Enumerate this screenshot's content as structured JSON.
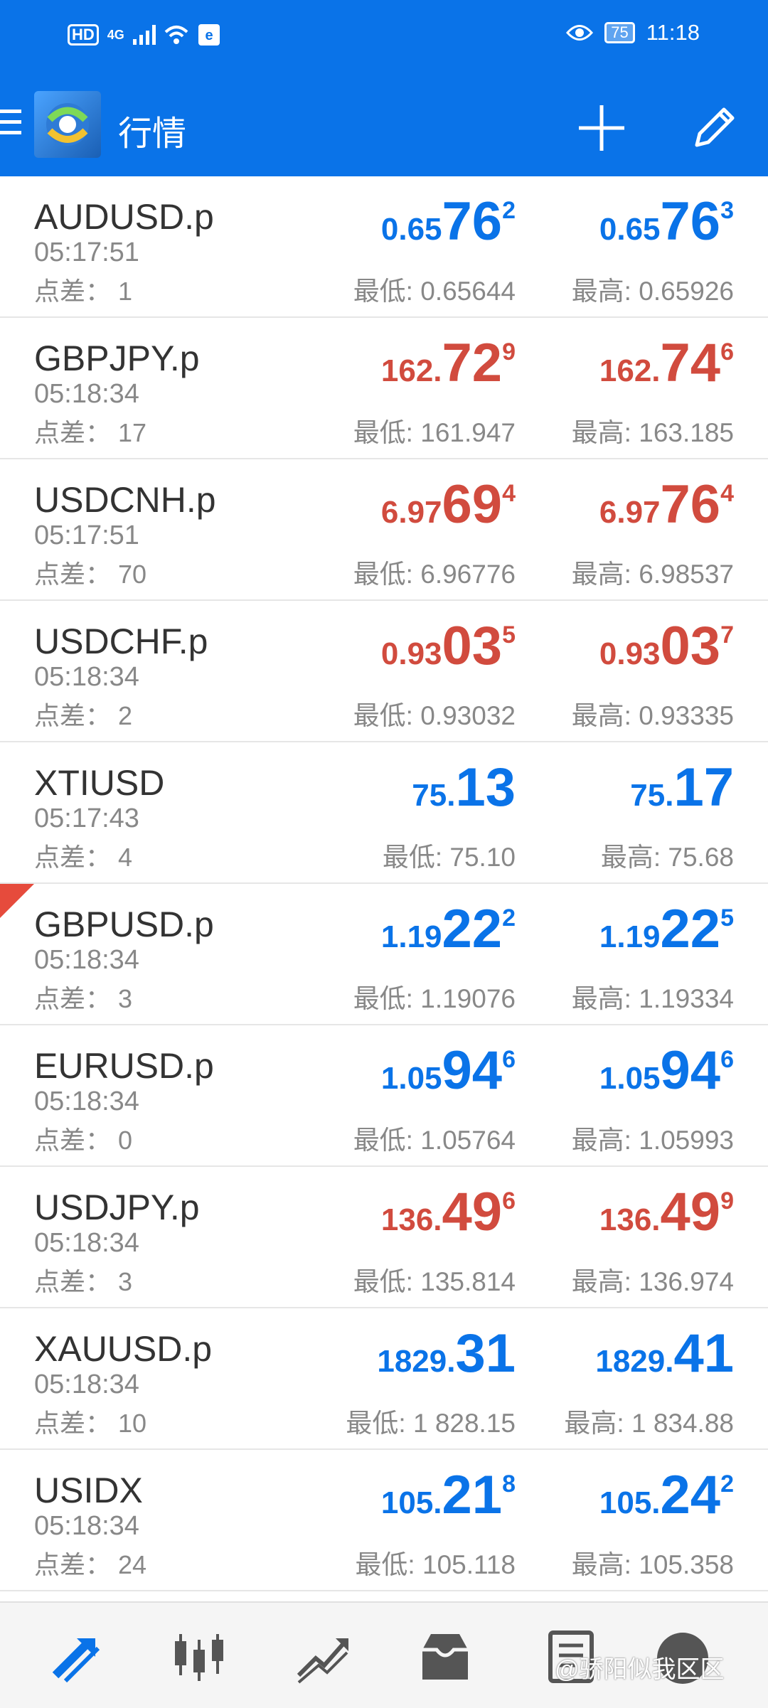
{
  "status_bar": {
    "hd": "HD",
    "network": "4G",
    "battery": "75",
    "time": "11:18"
  },
  "header": {
    "title": "行情"
  },
  "colors": {
    "accent": "#0a73e8",
    "price_up": "#0a73e8",
    "price_down": "#d14b3e"
  },
  "quotes": [
    {
      "symbol": "AUDUSD.p",
      "time": "05:17:51",
      "spread": "点差：  1",
      "bid_small": "0.65",
      "bid_big": "76",
      "bid_sup": "2",
      "ask_small": "0.65",
      "ask_big": "76",
      "ask_sup": "3",
      "low": "最低: 0.65644",
      "high": "最高: 0.65926",
      "color": "blue"
    },
    {
      "symbol": "GBPJPY.p",
      "time": "05:18:34",
      "spread": "点差：  17",
      "bid_small": "162.",
      "bid_big": "72",
      "bid_sup": "9",
      "ask_small": "162.",
      "ask_big": "74",
      "ask_sup": "6",
      "low": "最低: 161.947",
      "high": "最高: 163.185",
      "color": "red"
    },
    {
      "symbol": "USDCNH.p",
      "time": "05:17:51",
      "spread": "点差：  70",
      "bid_small": "6.97",
      "bid_big": "69",
      "bid_sup": "4",
      "ask_small": "6.97",
      "ask_big": "76",
      "ask_sup": "4",
      "low": "最低: 6.96776",
      "high": "最高: 6.98537",
      "color": "red"
    },
    {
      "symbol": "USDCHF.p",
      "time": "05:18:34",
      "spread": "点差：  2",
      "bid_small": "0.93",
      "bid_big": "03",
      "bid_sup": "5",
      "ask_small": "0.93",
      "ask_big": "03",
      "ask_sup": "7",
      "low": "最低: 0.93032",
      "high": "最高: 0.93335",
      "color": "red"
    },
    {
      "symbol": "XTIUSD",
      "time": "05:17:43",
      "spread": "点差：  4",
      "bid_small": "75.",
      "bid_big": "13",
      "bid_sup": "",
      "ask_small": "75.",
      "ask_big": "17",
      "ask_sup": "",
      "low": "最低: 75.10",
      "high": "最高: 75.68",
      "color": "blue"
    },
    {
      "symbol": "GBPUSD.p",
      "time": "05:18:34",
      "spread": "点差：  3",
      "bid_small": "1.19",
      "bid_big": "22",
      "bid_sup": "2",
      "ask_small": "1.19",
      "ask_big": "22",
      "ask_sup": "5",
      "low": "最低: 1.19076",
      "high": "最高: 1.19334",
      "color": "blue"
    },
    {
      "symbol": "EURUSD.p",
      "time": "05:18:34",
      "spread": "点差：  0",
      "bid_small": "1.05",
      "bid_big": "94",
      "bid_sup": "6",
      "ask_small": "1.05",
      "ask_big": "94",
      "ask_sup": "6",
      "low": "最低: 1.05764",
      "high": "最高: 1.05993",
      "color": "blue"
    },
    {
      "symbol": "USDJPY.p",
      "time": "05:18:34",
      "spread": "点差：  3",
      "bid_small": "136.",
      "bid_big": "49",
      "bid_sup": "6",
      "ask_small": "136.",
      "ask_big": "49",
      "ask_sup": "9",
      "low": "最低: 135.814",
      "high": "最高: 136.974",
      "color": "red"
    },
    {
      "symbol": "XAUUSD.p",
      "time": "05:18:34",
      "spread": "点差：  10",
      "bid_small": "1829.",
      "bid_big": "31",
      "bid_sup": "",
      "ask_small": "1829.",
      "ask_big": "41",
      "ask_sup": "",
      "low": "最低: 1 828.15",
      "high": "最高: 1 834.88",
      "color": "blue"
    },
    {
      "symbol": "USIDX",
      "time": "05:18:34",
      "spread": "点差：  24",
      "bid_small": "105.",
      "bid_big": "21",
      "bid_sup": "8",
      "ask_small": "105.",
      "ask_big": "24",
      "ask_sup": "2",
      "low": "最低: 105.118",
      "high": "最高: 105.358",
      "color": "blue"
    }
  ],
  "bottom_nav": {
    "items": [
      "quotes-icon",
      "chart-icon",
      "trade-icon",
      "history-icon",
      "news-icon",
      "messages-icon"
    ]
  },
  "watermark": "@骄阳似我区区"
}
